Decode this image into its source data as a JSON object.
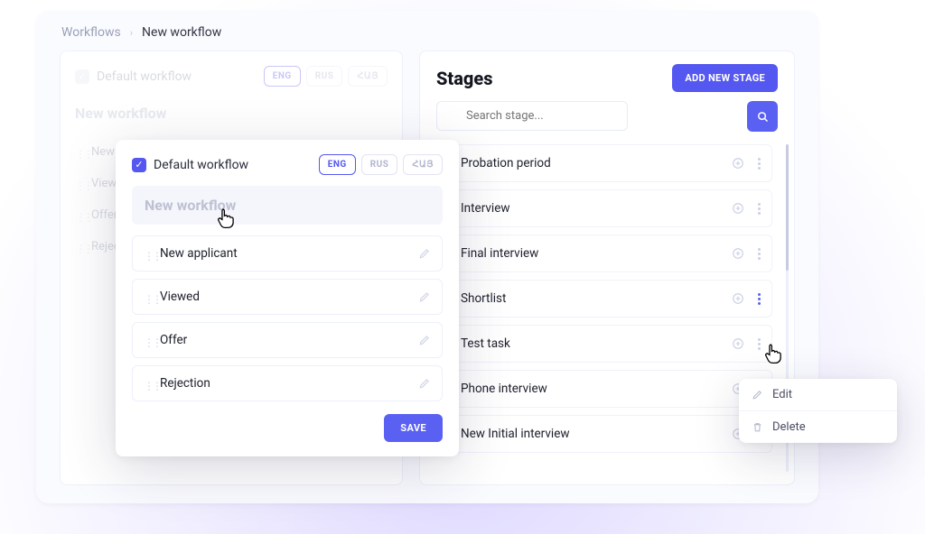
{
  "breadcrumb": {
    "root": "Workflows",
    "current": "New workflow"
  },
  "left_panel": {
    "default_label": "Default workflow",
    "title": "New workflow",
    "items": [
      "New applicant",
      "Viewed",
      "Offer",
      "Rejection"
    ],
    "langs": [
      "ENG",
      "RUS",
      "ՀԱՅ"
    ]
  },
  "editor": {
    "default_label": "Default workflow",
    "name_value": "New workflow",
    "langs": [
      "ENG",
      "RUS",
      "ՀԱՅ"
    ],
    "active_lang": "ENG",
    "items": [
      "New applicant",
      "Viewed",
      "Offer",
      "Rejection"
    ],
    "save": "SAVE"
  },
  "right_panel": {
    "title": "Stages",
    "add_label": "ADD NEW STAGE",
    "search_placeholder": "Search stage...",
    "stages": [
      "Probation period",
      "Interview",
      "Final interview",
      "Shortlist",
      "Test task",
      "Phone interview",
      "New Initial interview"
    ]
  },
  "popover": {
    "edit": "Edit",
    "delete": "Delete"
  }
}
